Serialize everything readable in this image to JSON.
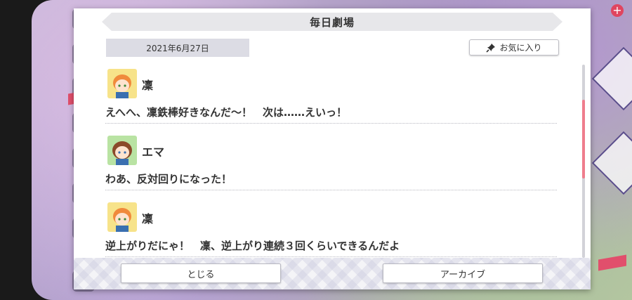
{
  "dialog": {
    "title": "毎日劇場",
    "date": "2021年6月27日",
    "favorite_label": "お気に入り"
  },
  "entries": [
    {
      "speaker": "凜",
      "text": "えへへ、凜鉄棒好きなんだ～！　次は……えいっ！",
      "avatar_color": "#f7e38a",
      "avatar_hair": "#f08a3c"
    },
    {
      "speaker": "エマ",
      "text": "わあ、反対回りになった！",
      "avatar_color": "#b9e3a3",
      "avatar_hair": "#8a4a2a"
    },
    {
      "speaker": "凜",
      "text": "逆上がりだにゃ！　凜、逆上がり連続３回くらいできるんだよ",
      "avatar_color": "#f7e38a",
      "avatar_hair": "#f08a3c"
    }
  ],
  "footer": {
    "close_label": "とじる",
    "archive_label": "アーカイブ"
  },
  "colors": {
    "scroll_thumb": "#ef7d8d",
    "accent_red": "#e14f6c"
  }
}
